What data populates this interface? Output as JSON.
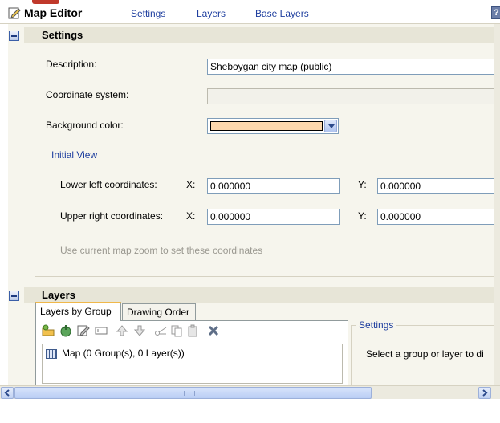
{
  "header": {
    "title": "Map Editor",
    "links": [
      "Settings",
      "Layers",
      "Base Layers"
    ],
    "help": "?"
  },
  "settings": {
    "section_title": "Settings",
    "description_label": "Description:",
    "description_value": "Sheboygan city map (public)",
    "coordinate_label": "Coordinate system:",
    "coordinate_value": "",
    "background_label": "Background color:",
    "background_color": "#fcd7ad",
    "initial_view": {
      "title": "Initial View",
      "lower_left_label": "Lower left coordinates:",
      "upper_right_label": "Upper right coordinates:",
      "x_label": "X:",
      "y_label": "Y:",
      "lower_left_x": "0.000000",
      "lower_left_y": "0.000000",
      "upper_right_x": "0.000000",
      "upper_right_y": "0.000000",
      "zoom_hint": "Use current map zoom to set these coordinates"
    }
  },
  "layers": {
    "section_title": "Layers",
    "tabs": [
      "Layers by Group",
      "Drawing Order"
    ],
    "tree_item": "Map (0 Group(s), 0 Layer(s))",
    "settings_title": "Settings",
    "settings_hint": "Select a group or layer to di"
  },
  "colors": {
    "link": "#1f3f9f",
    "accent": "#f0b84a",
    "panel": "#f6f5ed"
  }
}
